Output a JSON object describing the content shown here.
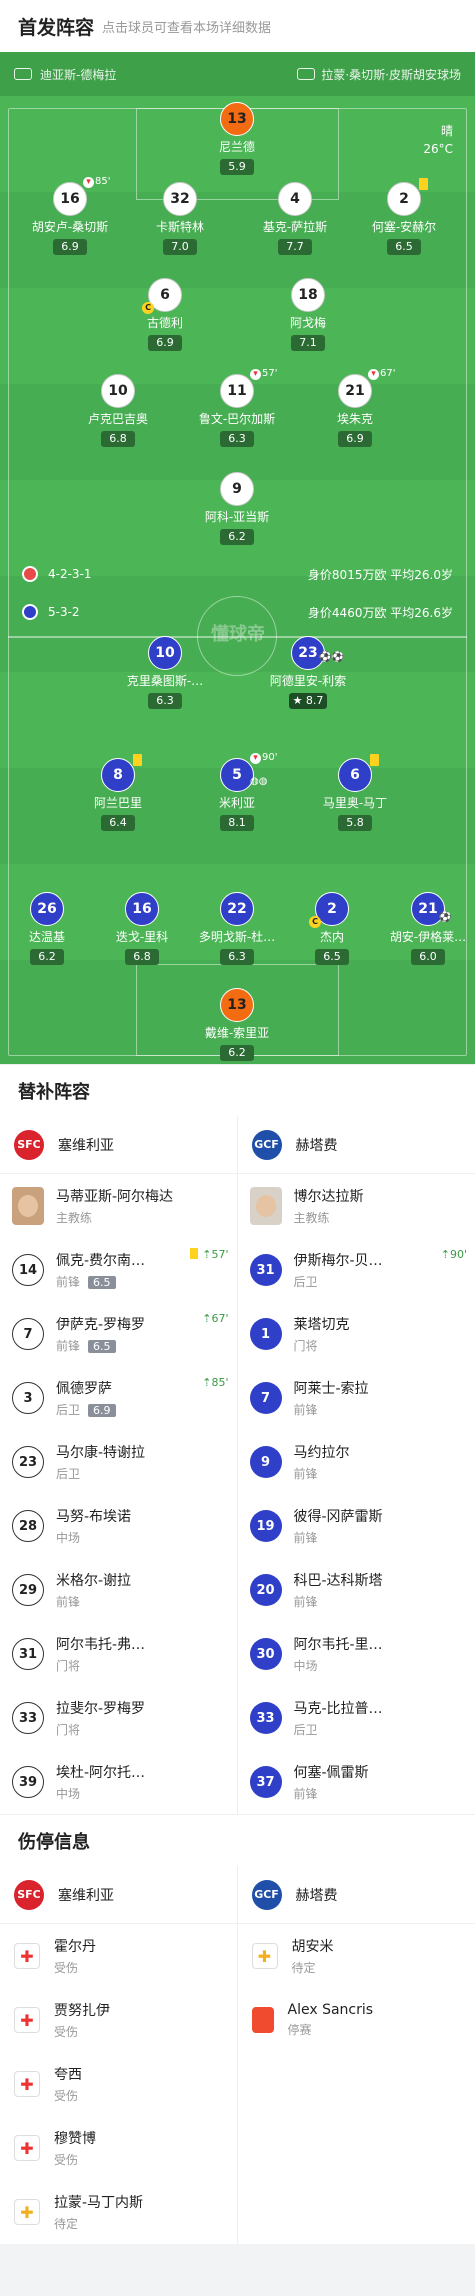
{
  "header": {
    "title": "首发阵容",
    "subtitle": "点击球员可查看本场详细数据"
  },
  "pitch": {
    "referee": "迪亚斯-德梅拉",
    "stadium": "拉蒙·桑切斯·皮斯胡安球场",
    "weather": "晴",
    "temperature": "26°C",
    "watermark": "懂球帝",
    "home_formation": "4-2-3-1",
    "home_stats": "身价8015万欧 平均26.0岁",
    "away_formation": "5-3-2",
    "away_stats": "身价4460万欧 平均26.6岁"
  },
  "home_players": [
    {
      "num": "13",
      "name": "尼兰德",
      "rating": "5.9"
    },
    {
      "num": "16",
      "name": "胡安卢-桑切斯",
      "rating": "6.9",
      "sub": "85'"
    },
    {
      "num": "32",
      "name": "卡斯特林",
      "rating": "7.0"
    },
    {
      "num": "4",
      "name": "基克-萨拉斯",
      "rating": "7.7"
    },
    {
      "num": "2",
      "name": "何塞-安赫尔",
      "rating": "6.5"
    },
    {
      "num": "6",
      "name": "古德利",
      "rating": "6.9",
      "captain": "C"
    },
    {
      "num": "18",
      "name": "阿戈梅",
      "rating": "7.1"
    },
    {
      "num": "10",
      "name": "卢克巴吉奥",
      "rating": "6.8"
    },
    {
      "num": "11",
      "name": "鲁文-巴尔加斯",
      "rating": "6.3",
      "sub": "57'"
    },
    {
      "num": "21",
      "name": "埃朱克",
      "rating": "6.9",
      "sub": "67'"
    },
    {
      "num": "9",
      "name": "阿科-亚当斯",
      "rating": "6.2"
    }
  ],
  "away_players": [
    {
      "num": "10",
      "name": "克里桑图斯-…",
      "rating": "6.3"
    },
    {
      "num": "23",
      "name": "阿德里安-利索",
      "rating": "8.7"
    },
    {
      "num": "8",
      "name": "阿兰巴里",
      "rating": "6.4"
    },
    {
      "num": "5",
      "name": "米利亚",
      "rating": "8.1",
      "sub": "90'"
    },
    {
      "num": "6",
      "name": "马里奥-马丁",
      "rating": "5.8"
    },
    {
      "num": "26",
      "name": "达温基",
      "rating": "6.2"
    },
    {
      "num": "16",
      "name": "迭戈-里科",
      "rating": "6.8"
    },
    {
      "num": "22",
      "name": "多明戈斯-杜…",
      "rating": "6.3"
    },
    {
      "num": "2",
      "name": "杰内",
      "rating": "6.5",
      "captain": "C"
    },
    {
      "num": "21",
      "name": "胡安-伊格莱…",
      "rating": "6.0"
    },
    {
      "num": "13",
      "name": "戴维-索里亚",
      "rating": "6.2"
    }
  ],
  "subs": {
    "title": "替补阵容",
    "home_team": "塞维利亚",
    "away_team": "赫塔费",
    "home_crest": "SFC",
    "away_crest": "GCF",
    "home_coach": {
      "name": "马蒂亚斯-阿尔梅达",
      "role": "主教练"
    },
    "away_coach": {
      "name": "博尔达拉斯",
      "role": "主教练"
    },
    "home": [
      {
        "num": "14",
        "name": "佩克-费尔南…",
        "pos": "前锋",
        "rating": "6.5",
        "in": "57'",
        "card": true
      },
      {
        "num": "7",
        "name": "伊萨克-罗梅罗",
        "pos": "前锋",
        "rating": "6.5",
        "in": "67'"
      },
      {
        "num": "3",
        "name": "佩德罗萨",
        "pos": "后卫",
        "rating": "6.9",
        "in": "85'"
      },
      {
        "num": "23",
        "name": "马尔康-特谢拉",
        "pos": "后卫"
      },
      {
        "num": "28",
        "name": "马努-布埃诺",
        "pos": "中场"
      },
      {
        "num": "29",
        "name": "米格尔-谢拉",
        "pos": "前锋"
      },
      {
        "num": "31",
        "name": "阿尔韦托-弗…",
        "pos": "门将"
      },
      {
        "num": "33",
        "name": "拉斐尔-罗梅罗",
        "pos": "门将"
      },
      {
        "num": "39",
        "name": "埃杜-阿尔托…",
        "pos": "中场"
      }
    ],
    "away": [
      {
        "num": "31",
        "name": "伊斯梅尔-贝…",
        "pos": "后卫",
        "in": "90'"
      },
      {
        "num": "1",
        "name": "莱塔切克",
        "pos": "门将"
      },
      {
        "num": "7",
        "name": "阿莱士-索拉",
        "pos": "前锋"
      },
      {
        "num": "9",
        "name": "马约拉尔",
        "pos": "前锋"
      },
      {
        "num": "19",
        "name": "彼得-冈萨雷斯",
        "pos": "前锋"
      },
      {
        "num": "20",
        "name": "科巴-达科斯塔",
        "pos": "前锋"
      },
      {
        "num": "30",
        "name": "阿尔韦托-里…",
        "pos": "中场"
      },
      {
        "num": "33",
        "name": "马克-比拉普…",
        "pos": "后卫"
      },
      {
        "num": "37",
        "name": "何塞-佩雷斯",
        "pos": "前锋"
      }
    ]
  },
  "injuries": {
    "title": "伤停信息",
    "home": [
      {
        "name": "霍尔丹",
        "status": "受伤",
        "icon": "injury-icon"
      },
      {
        "name": "贾努扎伊",
        "status": "受伤",
        "icon": "injury-icon"
      },
      {
        "name": "夸西",
        "status": "受伤",
        "icon": "injury-icon"
      },
      {
        "name": "穆赞博",
        "status": "受伤",
        "icon": "injury-icon"
      },
      {
        "name": "拉蒙-马丁内斯",
        "status": "待定",
        "icon": "doubtful-icon"
      }
    ],
    "away": [
      {
        "name": "胡安米",
        "status": "待定",
        "icon": "doubtful-icon"
      },
      {
        "name": "Alex Sancris",
        "status": "停赛",
        "icon": "red-card-icon"
      }
    ]
  }
}
